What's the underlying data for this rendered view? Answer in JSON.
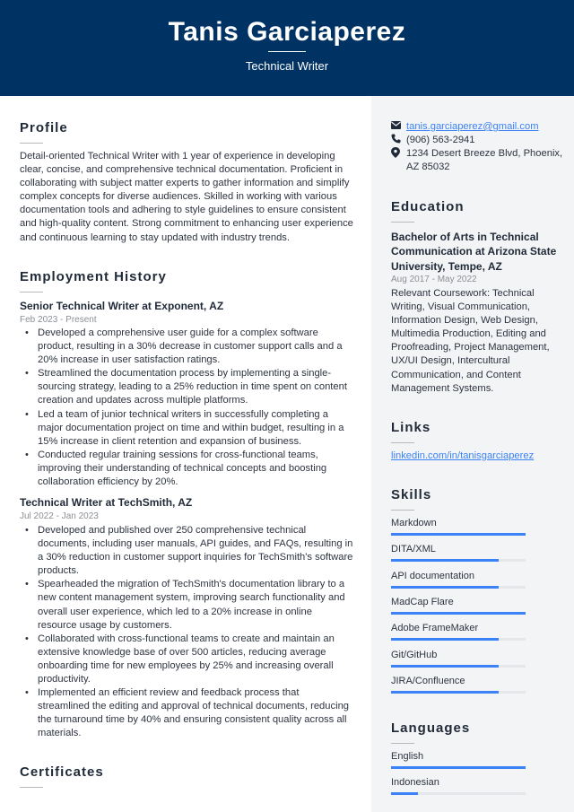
{
  "header": {
    "name": "Tanis Garciaperez",
    "title": "Technical Writer"
  },
  "colors": {
    "header_bg": "#003263",
    "accent": "#3b82f6",
    "sidebar_bg": "#f3f4f6"
  },
  "profile": {
    "heading": "Profile",
    "text": "Detail-oriented Technical Writer with 1 year of experience in developing clear, concise, and comprehensive technical documentation. Proficient in collaborating with subject matter experts to gather information and simplify complex concepts for diverse audiences. Skilled in working with various documentation tools and adhering to style guidelines to ensure consistent and high-quality content. Strong commitment to enhancing user experience and continuous learning to stay updated with industry trends."
  },
  "employment": {
    "heading": "Employment History",
    "jobs": [
      {
        "title": "Senior Technical Writer at Exponent, AZ",
        "dates": "Feb 2023 - Present",
        "bullets": [
          "Developed a comprehensive user guide for a complex software product, resulting in a 30% decrease in customer support calls and a 20% increase in user satisfaction ratings.",
          "Streamlined the documentation process by implementing a single-sourcing strategy, leading to a 25% reduction in time spent on content creation and updates across multiple platforms.",
          "Led a team of junior technical writers in successfully completing a major documentation project on time and within budget, resulting in a 15% increase in client retention and expansion of business.",
          "Conducted regular training sessions for cross-functional teams, improving their understanding of technical concepts and boosting collaboration efficiency by 20%."
        ]
      },
      {
        "title": "Technical Writer at TechSmith, AZ",
        "dates": "Jul 2022 - Jan 2023",
        "bullets": [
          "Developed and published over 250 comprehensive technical documents, including user manuals, API guides, and FAQs, resulting in a 30% reduction in customer support inquiries for TechSmith's software products.",
          "Spearheaded the migration of TechSmith's documentation library to a new content management system, improving search functionality and overall user experience, which led to a 20% increase in online resource usage by customers.",
          "Collaborated with cross-functional teams to create and maintain an extensive knowledge base of over 500 articles, reducing average onboarding time for new employees by 25% and increasing overall productivity.",
          "Implemented an efficient review and feedback process that streamlined the editing and approval of technical documents, reducing the turnaround time by 40% and ensuring consistent quality across all materials."
        ]
      }
    ]
  },
  "certificates": {
    "heading": "Certificates"
  },
  "contact": {
    "email": "tanis.garciaperez@gmail.com",
    "phone": "(906) 563-2941",
    "address": "1234 Desert Breeze Blvd, Phoenix, AZ 85032",
    "icons": [
      "envelope-icon",
      "phone-icon",
      "map-pin-icon"
    ]
  },
  "education": {
    "heading": "Education",
    "degree": "Bachelor of Arts in Technical Communication at Arizona State University, Tempe, AZ",
    "dates": "Aug 2017 - May 2022",
    "description": "Relevant Coursework: Technical Writing, Visual Communication, Information Design, Web Design, Multimedia Production, Editing and Proofreading, Project Management, UX/UI Design, Intercultural Communication, and Content Management Systems."
  },
  "links": {
    "heading": "Links",
    "items": [
      "linkedin.com/in/tanisgarciaperez"
    ]
  },
  "skills": {
    "heading": "Skills",
    "items": [
      {
        "label": "Markdown",
        "level": 1.0
      },
      {
        "label": "DITA/XML",
        "level": 0.8
      },
      {
        "label": "API documentation",
        "level": 0.8
      },
      {
        "label": "MadCap Flare",
        "level": 1.0
      },
      {
        "label": "Adobe FrameMaker",
        "level": 0.8
      },
      {
        "label": "Git/GitHub",
        "level": 0.8
      },
      {
        "label": "JIRA/Confluence",
        "level": 0.8
      }
    ]
  },
  "languages": {
    "heading": "Languages",
    "items": [
      {
        "label": "English",
        "level": 1.0
      },
      {
        "label": "Indonesian",
        "level": 0.2
      }
    ]
  }
}
